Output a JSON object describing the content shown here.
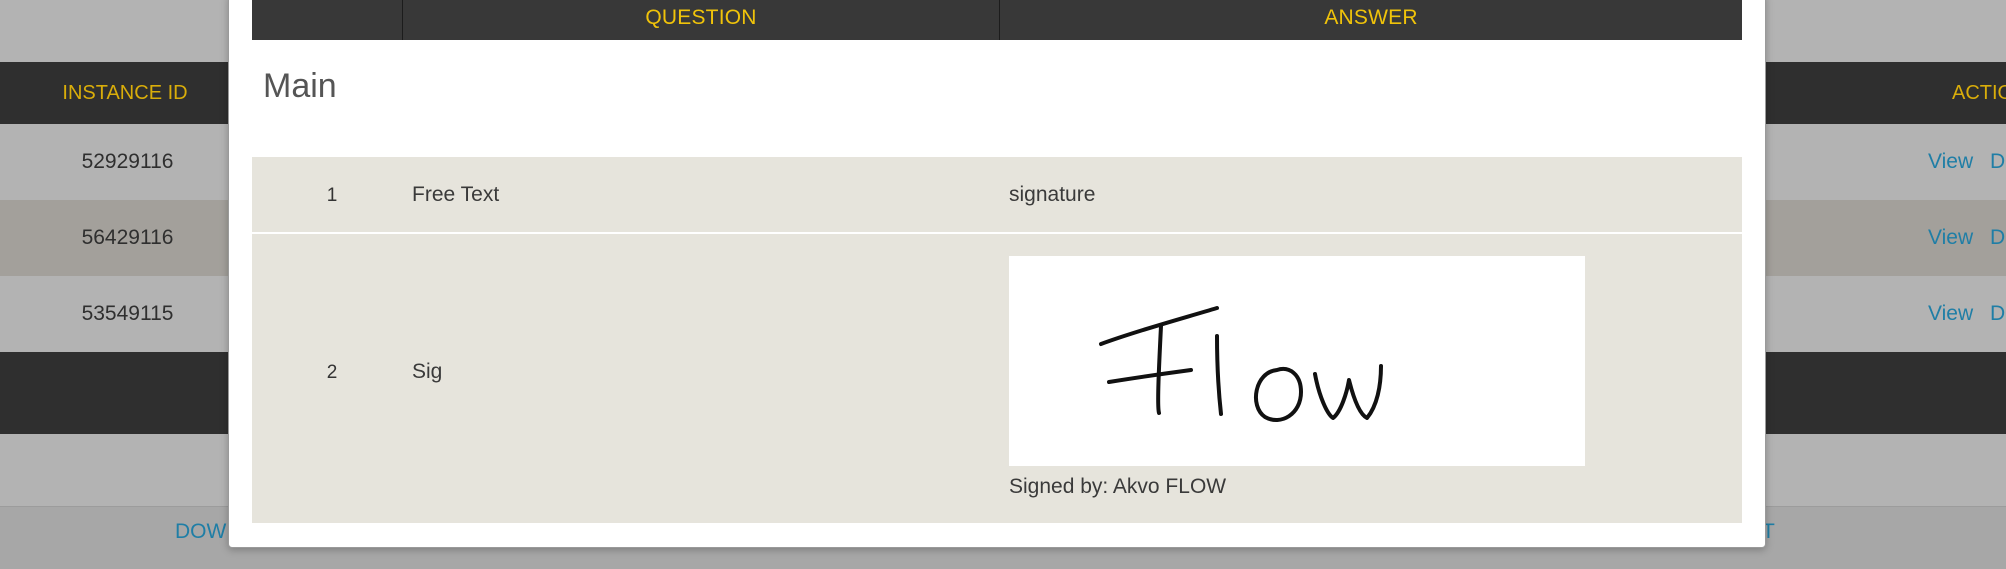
{
  "background": {
    "table": {
      "col_instance_id": "INSTANCE ID",
      "col_action_partial": "ACTIO",
      "rows": [
        {
          "instance_id": "52929116",
          "view": "View",
          "d": "D"
        },
        {
          "instance_id": "56429116",
          "view": "View",
          "d": "D"
        },
        {
          "instance_id": "53549115",
          "view": "View",
          "d": "D"
        }
      ]
    },
    "footer": {
      "download_partial": "DOW",
      "right_partial": "T"
    }
  },
  "modal": {
    "header": {
      "question": "QUESTION",
      "answer": "ANSWER"
    },
    "group_title": "Main",
    "questions": [
      {
        "number": "1",
        "text": "Free Text",
        "answer": "signature"
      },
      {
        "number": "2",
        "text": "Sig",
        "signed_by": "Signed by: Akvo FLOW"
      }
    ]
  },
  "colors": {
    "header_bg": "#383838",
    "header_text": "#f0c30a",
    "row_bg": "#e6e4dc",
    "link": "#1f7ea6"
  }
}
